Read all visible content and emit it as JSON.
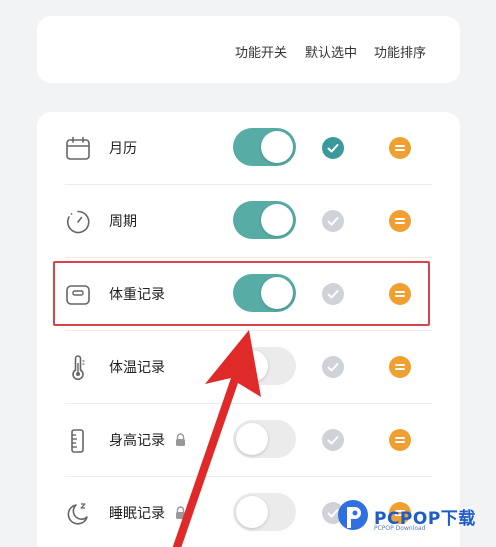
{
  "header": {
    "col_toggle": "功能开关",
    "col_default": "默认选中",
    "col_sort": "功能排序"
  },
  "rows": [
    {
      "label": "月历",
      "icon": "calendar-icon",
      "toggle_on": true,
      "default_selected": true,
      "locked": false
    },
    {
      "label": "周期",
      "icon": "cycle-timer-icon",
      "toggle_on": true,
      "default_selected": false,
      "locked": false
    },
    {
      "label": "体重记录",
      "icon": "scale-icon",
      "toggle_on": true,
      "default_selected": false,
      "locked": false
    },
    {
      "label": "体温记录",
      "icon": "thermometer-icon",
      "toggle_on": false,
      "default_selected": false,
      "locked": false
    },
    {
      "label": "身高记录",
      "icon": "ruler-icon",
      "toggle_on": false,
      "default_selected": false,
      "locked": true
    },
    {
      "label": "睡眠记录",
      "icon": "moon-sleep-icon",
      "toggle_on": false,
      "default_selected": false,
      "locked": true
    }
  ],
  "colors": {
    "toggle_on": "#58aca6",
    "check_active": "#3a9a9a",
    "check_inactive": "#cfd2d6",
    "sort_icon": "#f0a030",
    "highlight": "#d8444a",
    "arrow": "#e02a2a"
  },
  "watermark": {
    "title": "PCPOP下载",
    "subtitle": "PCPOP Download"
  }
}
